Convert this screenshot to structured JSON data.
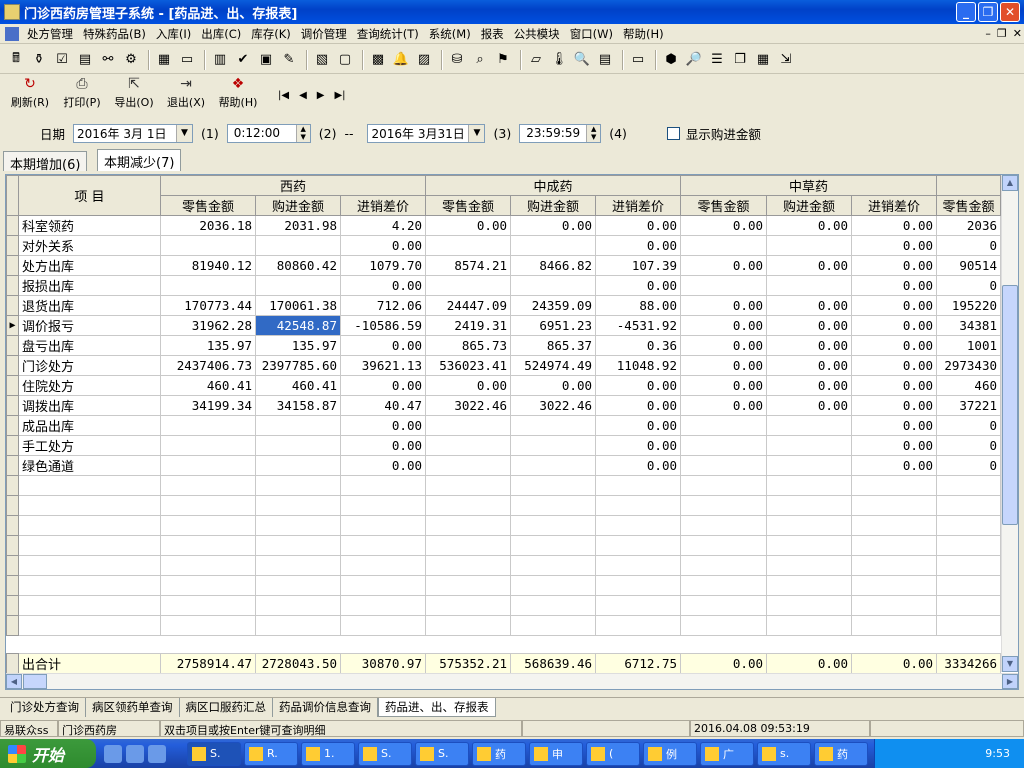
{
  "window": {
    "title": "门诊西药房管理子系统 - [药品进、出、存报表]"
  },
  "menu": [
    "处方管理",
    "特殊药品(B)",
    "入库(I)",
    "出库(C)",
    "库存(K)",
    "调价管理",
    "查询统计(T)",
    "系统(M)",
    "报表",
    "公共模块",
    "窗口(W)",
    "帮助(H)"
  ],
  "actions": [
    {
      "label": "刷新(R)",
      "icon": "refresh-icon"
    },
    {
      "label": "打印(P)",
      "icon": "print-icon"
    },
    {
      "label": "导出(O)",
      "icon": "export-icon"
    },
    {
      "label": "退出(X)",
      "icon": "exit-icon"
    },
    {
      "label": "帮助(H)",
      "icon": "help-icon"
    }
  ],
  "nav": [
    "|◀",
    "◀",
    "▶",
    "▶|"
  ],
  "filter": {
    "date_label": "日期",
    "start_date": "2016年 3月 1日",
    "start_time": "0:12:00",
    "end_date": "2016年 3月31日",
    "end_time": "23:59:59",
    "sep": "--",
    "n1": "(1)",
    "n2": "(2)",
    "n3": "(3)",
    "n4": "(4)",
    "show_purchase_label": "显示购进金额"
  },
  "tabs": [
    "本期增加(6)",
    "本期减少(7)"
  ],
  "grid": {
    "item_header": "项    目",
    "groups": [
      "西药",
      "中成药",
      "中草药"
    ],
    "subheaders": [
      "零售金额",
      "购进金额",
      "进销差价",
      "零售金额",
      "购进金额",
      "进销差价",
      "零售金额",
      "购进金额",
      "进销差价",
      "零售金额"
    ],
    "rows": [
      {
        "label": "科室领药",
        "c": [
          "2036.18",
          "2031.98",
          "4.20",
          "0.00",
          "0.00",
          "0.00",
          "0.00",
          "0.00",
          "0.00",
          "2036"
        ]
      },
      {
        "label": "对外关系",
        "c": [
          "",
          "",
          "0.00",
          "",
          "",
          "0.00",
          "",
          "",
          "0.00",
          "0"
        ]
      },
      {
        "label": "处方出库",
        "c": [
          "81940.12",
          "80860.42",
          "1079.70",
          "8574.21",
          "8466.82",
          "107.39",
          "0.00",
          "0.00",
          "0.00",
          "90514"
        ]
      },
      {
        "label": "报损出库",
        "c": [
          "",
          "",
          "0.00",
          "",
          "",
          "0.00",
          "",
          "",
          "0.00",
          "0"
        ]
      },
      {
        "label": "退货出库",
        "c": [
          "170773.44",
          "170061.38",
          "712.06",
          "24447.09",
          "24359.09",
          "88.00",
          "0.00",
          "0.00",
          "0.00",
          "195220"
        ]
      },
      {
        "label": "调价报亏",
        "c": [
          "31962.28",
          "42548.87",
          "-10586.59",
          "2419.31",
          "6951.23",
          "-4531.92",
          "0.00",
          "0.00",
          "0.00",
          "34381"
        ]
      },
      {
        "label": "盘亏出库",
        "c": [
          "135.97",
          "135.97",
          "0.00",
          "865.73",
          "865.37",
          "0.36",
          "0.00",
          "0.00",
          "0.00",
          "1001"
        ]
      },
      {
        "label": "门诊处方",
        "c": [
          "2437406.73",
          "2397785.60",
          "39621.13",
          "536023.41",
          "524974.49",
          "11048.92",
          "0.00",
          "0.00",
          "0.00",
          "2973430"
        ]
      },
      {
        "label": "住院处方",
        "c": [
          "460.41",
          "460.41",
          "0.00",
          "0.00",
          "0.00",
          "0.00",
          "0.00",
          "0.00",
          "0.00",
          "460"
        ]
      },
      {
        "label": "调拨出库",
        "c": [
          "34199.34",
          "34158.87",
          "40.47",
          "3022.46",
          "3022.46",
          "0.00",
          "0.00",
          "0.00",
          "0.00",
          "37221"
        ]
      },
      {
        "label": "成品出库",
        "c": [
          "",
          "",
          "0.00",
          "",
          "",
          "0.00",
          "",
          "",
          "0.00",
          "0"
        ]
      },
      {
        "label": "手工处方",
        "c": [
          "",
          "",
          "0.00",
          "",
          "",
          "0.00",
          "",
          "",
          "0.00",
          "0"
        ]
      },
      {
        "label": "绿色通道",
        "c": [
          "",
          "",
          "0.00",
          "",
          "",
          "0.00",
          "",
          "",
          "0.00",
          "0"
        ]
      }
    ],
    "total": {
      "label": "出合计",
      "c": [
        "2758914.47",
        "2728043.50",
        "30870.97",
        "575352.21",
        "568639.46",
        "6712.75",
        "0.00",
        "0.00",
        "0.00",
        "3334266"
      ]
    }
  },
  "bottom_tabs": [
    "门诊处方查询",
    "病区领药单查询",
    "病区口服药汇总",
    "药品调价信息查询",
    "药品进、出、存报表"
  ],
  "status": [
    "易联众ss",
    "门诊西药房",
    "双击项目或按Enter键可查询明细",
    "",
    "2016.04.08 09:53:19",
    ""
  ],
  "taskbar": {
    "start": "开始",
    "items": [
      "S.",
      "R.",
      "1.",
      "S.",
      "S.",
      "药",
      "申",
      "(",
      "例",
      "广",
      "s.",
      "药"
    ],
    "time": "9:53"
  }
}
